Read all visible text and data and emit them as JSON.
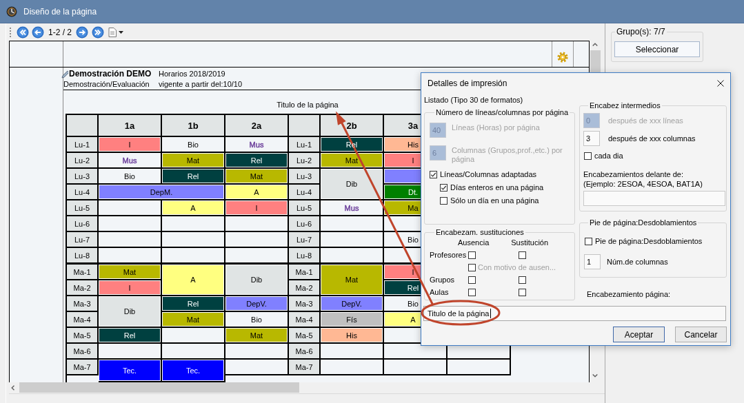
{
  "window": {
    "title": "Diseño de la página"
  },
  "toolbar": {
    "page_indicator": "1-2 / 2"
  },
  "preview": {
    "header": {
      "school": "Demostración DEMO",
      "subtitle": "Demostración/Evaluación",
      "schedule": "Horarios 2018/2019",
      "valid_from": "vigente a partir del:10/10"
    },
    "page_title": "Titulo de la página",
    "blocks": [
      {
        "columns": [
          "1a",
          "1b",
          "2a"
        ],
        "days": [
          {
            "rows": [
              {
                "label": "Lu-1",
                "cells": [
                  {
                    "text": "I",
                    "color": "#ff8080",
                    "filled": true
                  },
                  {
                    "text": "Bio"
                  },
                  {
                    "text": "Mus",
                    "color": "#6a3d9a",
                    "filled": false
                  }
                ]
              },
              {
                "label": "Lu-2",
                "cells": [
                  {
                    "text": "Mus",
                    "color": "#6a3d9a",
                    "filled": false
                  },
                  {
                    "text": "Mat",
                    "color": "#b8b800",
                    "filled": true
                  },
                  {
                    "text": "Rel",
                    "color": "#004040",
                    "filled": true
                  }
                ]
              },
              {
                "label": "Lu-3",
                "cells": [
                  {
                    "text": "Bio"
                  },
                  {
                    "text": "Rel",
                    "color": "#004040",
                    "filled": true
                  },
                  {
                    "text": "Mat",
                    "color": "#b8b800",
                    "filled": true
                  }
                ]
              },
              {
                "label": "Lu-4",
                "cells": [
                  {
                    "text": "DepM.",
                    "color": "#8080ff",
                    "filled": true,
                    "colspan": 2
                  },
                  {
                    "text": "A",
                    "color": "#ffff80",
                    "filled": true
                  }
                ]
              },
              {
                "label": "Lu-5",
                "cells": [
                  null,
                  {
                    "text": "A",
                    "color": "#ffff80",
                    "filled": true
                  },
                  {
                    "text": "I",
                    "color": "#ff8080",
                    "filled": true
                  }
                ]
              },
              {
                "label": "Lu-6",
                "cells": [
                  null,
                  null,
                  null
                ]
              },
              {
                "label": "Lu-7",
                "cells": [
                  null,
                  null,
                  null
                ]
              },
              {
                "label": "Lu-8",
                "cells": [
                  null,
                  null,
                  null
                ]
              }
            ]
          },
          {
            "rows": [
              {
                "label": "Ma-1",
                "cells": [
                  {
                    "text": "Mat",
                    "color": "#b8b800",
                    "filled": true
                  },
                  {
                    "text": "A",
                    "color": "#ffff80",
                    "filled": true,
                    "rowspan": 2
                  },
                  {
                    "text": "Dib",
                    "color": "#e0e4e4",
                    "filled": true,
                    "rowspan": 2
                  }
                ]
              },
              {
                "label": "Ma-2",
                "cells": [
                  {
                    "text": "I",
                    "color": "#ff8080",
                    "filled": true
                  }
                ]
              },
              {
                "label": "Ma-3",
                "cells": [
                  {
                    "text": "Dib",
                    "color": "#e0e4e4",
                    "filled": true,
                    "rowspan": 2
                  },
                  {
                    "text": "Rel",
                    "color": "#004040",
                    "filled": true
                  },
                  {
                    "text": "DepV.",
                    "color": "#8080ff",
                    "filled": true
                  }
                ]
              },
              {
                "label": "Ma-4",
                "cells": [
                  {
                    "text": "Mat",
                    "color": "#b8b800",
                    "filled": true
                  },
                  {
                    "text": "Bio"
                  }
                ]
              },
              {
                "label": "Ma-5",
                "cells": [
                  {
                    "text": "Rel",
                    "color": "#004040",
                    "filled": true
                  },
                  null,
                  {
                    "text": "Mat",
                    "color": "#b8b800",
                    "filled": true
                  }
                ]
              },
              {
                "label": "Ma-6",
                "cells": [
                  null,
                  null,
                  null
                ]
              },
              {
                "label": "Ma-7",
                "cells": [
                  {
                    "text": "Tec.",
                    "color": "#0000ff",
                    "filled": true,
                    "rowspan": 2
                  },
                  {
                    "text": "Tec.",
                    "color": "#0000ff",
                    "filled": true,
                    "rowspan": 2
                  },
                  null
                ]
              }
            ]
          }
        ]
      },
      {
        "columns": [
          "2b",
          "3a",
          null
        ],
        "days": [
          {
            "rows": [
              {
                "label": "Lu-1",
                "cells": [
                  {
                    "text": "Rel",
                    "color": "#004040",
                    "filled": true
                  },
                  {
                    "text": "His",
                    "color": "#ffb894",
                    "filled": true
                  },
                  null
                ]
              },
              {
                "label": "Lu-2",
                "cells": [
                  {
                    "text": "Mat",
                    "color": "#b8b800",
                    "filled": true
                  },
                  {
                    "text": "I",
                    "color": "#ff8080",
                    "filled": true
                  },
                  null
                ]
              },
              {
                "label": "Lu-3",
                "cells": [
                  {
                    "text": "Dib",
                    "color": "#e0e4e4",
                    "filled": true,
                    "rowspan": 2
                  },
                  {
                    "color": "#8080ff",
                    "filled": true
                  },
                  null
                ]
              },
              {
                "label": "Lu-4",
                "cells": [
                  {
                    "text": "Dt.",
                    "color": "#008000",
                    "filled": true
                  },
                  null
                ]
              },
              {
                "label": "Lu-5",
                "cells": [
                  {
                    "text": "Mus",
                    "color": "#6a3d9a",
                    "filled": false
                  },
                  {
                    "text": "Ma",
                    "color": "#b8b800",
                    "filled": true
                  },
                  null
                ]
              },
              {
                "label": "Lu-6",
                "cells": [
                  null,
                  null,
                  null
                ]
              },
              {
                "label": "Lu-7",
                "cells": [
                  null,
                  {
                    "text": "Bio"
                  },
                  null
                ]
              },
              {
                "label": "Lu-8",
                "cells": [
                  null,
                  null,
                  null
                ]
              }
            ]
          },
          {
            "rows": [
              {
                "label": "Ma-1",
                "cells": [
                  {
                    "text": "Mat",
                    "color": "#b8b800",
                    "filled": true,
                    "rowspan": 2
                  },
                  {
                    "text": "I",
                    "color": "#ff8080",
                    "filled": true
                  },
                  null
                ]
              },
              {
                "label": "Ma-2",
                "cells": [
                  {
                    "text": "Rel",
                    "color": "#004040",
                    "filled": true
                  },
                  null
                ]
              },
              {
                "label": "Ma-3",
                "cells": [
                  {
                    "text": "DepV.",
                    "color": "#8080ff",
                    "filled": true
                  },
                  {
                    "text": "Bio"
                  },
                  null
                ]
              },
              {
                "label": "Ma-4",
                "cells": [
                  {
                    "text": "Fís",
                    "color": "#c0c0c0",
                    "filled": true
                  },
                  {
                    "text": "A",
                    "color": "#ffff80",
                    "filled": true
                  },
                  null
                ]
              },
              {
                "label": "Ma-5",
                "cells": [
                  {
                    "text": "His",
                    "color": "#ffb894",
                    "filled": true
                  },
                  null,
                  null
                ]
              },
              {
                "label": "Ma-6",
                "cells": [
                  null,
                  null,
                  null
                ]
              },
              {
                "label": "Ma-7",
                "cells": [
                  null,
                  null,
                  null
                ]
              }
            ]
          }
        ]
      }
    ]
  },
  "dialog": {
    "title": "Detalles de impresión",
    "listing_type": "Listado (Tipo 30 de formatos)",
    "page_size_group": {
      "legend": "Número de líneas/columnas por página",
      "fields": [
        {
          "value": "40",
          "label": "Líneas (Horas) por página",
          "disabled": true
        },
        {
          "value": "6",
          "label": "Columnas (Grupos,prof.,etc.) por página",
          "disabled": true
        }
      ],
      "options": [
        {
          "label": "Líneas/Columnas adaptadas",
          "checked": true,
          "children": [
            {
              "label": "Días enteros en una página",
              "checked": true
            },
            {
              "label": "Sólo un día en una página",
              "checked": false
            }
          ]
        }
      ]
    },
    "substitutions_group": {
      "legend": "Encabezam. sustituciones",
      "columns": [
        "Ausencia",
        "Sustitución"
      ],
      "rows": [
        {
          "label": "Profesores",
          "checks": [
            {
              "checked": false
            },
            {
              "checked": false
            }
          ],
          "children": [
            {
              "label": "Con motivo de ausen...",
              "checked": false,
              "disabled": true
            }
          ]
        },
        {
          "label": "Grupos",
          "checks": [
            {
              "checked": false
            },
            {
              "checked": false
            }
          ]
        },
        {
          "label": "Aulas",
          "checks": [
            {
              "checked": false
            },
            {
              "checked": false
            }
          ]
        }
      ]
    },
    "intermediate_group": {
      "legend": "Encabez intermedios",
      "fields": [
        {
          "value": "0",
          "label": "después de xxx líneas",
          "disabled": true
        },
        {
          "value": "3",
          "label": "después de xxx columnas",
          "disabled": false
        }
      ],
      "each_day": {
        "label": "cada dia",
        "checked": false
      },
      "prefix_label": "Encabezamientos delante de:",
      "prefix_example": "(Ejemplo: 2ESOA, 4ESOA, BAT1A)"
    },
    "footer_group": {
      "legend": "Pie de página:Desdoblamientos",
      "option": {
        "label": "Pie de página:Desdoblamientos",
        "checked": false
      },
      "field": {
        "value": "1",
        "label": "Núm.de columnas",
        "disabled": false
      }
    },
    "page_header": {
      "label": "Encabezamiento página:",
      "value": "Titulo de la página"
    },
    "buttons": [
      {
        "label": "Aceptar",
        "default": true
      },
      {
        "label": "Cancelar",
        "default": false
      }
    ]
  },
  "side_panel": {
    "groups_legend": "Grupo(s): 7/7",
    "select_button": "Seleccionar"
  }
}
